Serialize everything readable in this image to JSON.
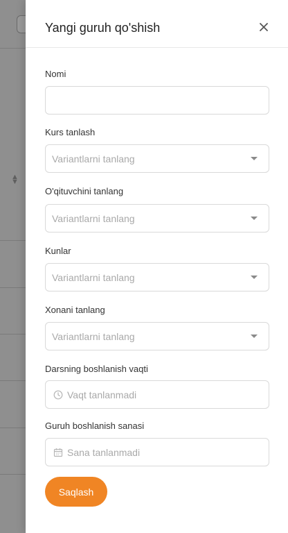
{
  "drawer": {
    "title": "Yangi guruh qo'shish",
    "accent_color": "#f08524",
    "fields": {
      "name": {
        "label": "Nomi",
        "value": ""
      },
      "course": {
        "label": "Kurs tanlash",
        "placeholder": "Variantlarni tanlang"
      },
      "teacher": {
        "label": "O'qituvchini tanlang",
        "placeholder": "Variantlarni tanlang"
      },
      "days": {
        "label": "Kunlar",
        "placeholder": "Variantlarni tanlang"
      },
      "room": {
        "label": "Xonani tanlang",
        "placeholder": "Variantlarni tanlang"
      },
      "start_time": {
        "label": "Darsning boshlanish vaqti",
        "placeholder": "Vaqt tanlanmadi",
        "icon": "clock-icon"
      },
      "start_date": {
        "label": "Guruh boshlanish sanasi",
        "placeholder": "Sana tanlanmadi",
        "icon": "calendar-icon"
      }
    },
    "save_label": "Saqlash"
  }
}
